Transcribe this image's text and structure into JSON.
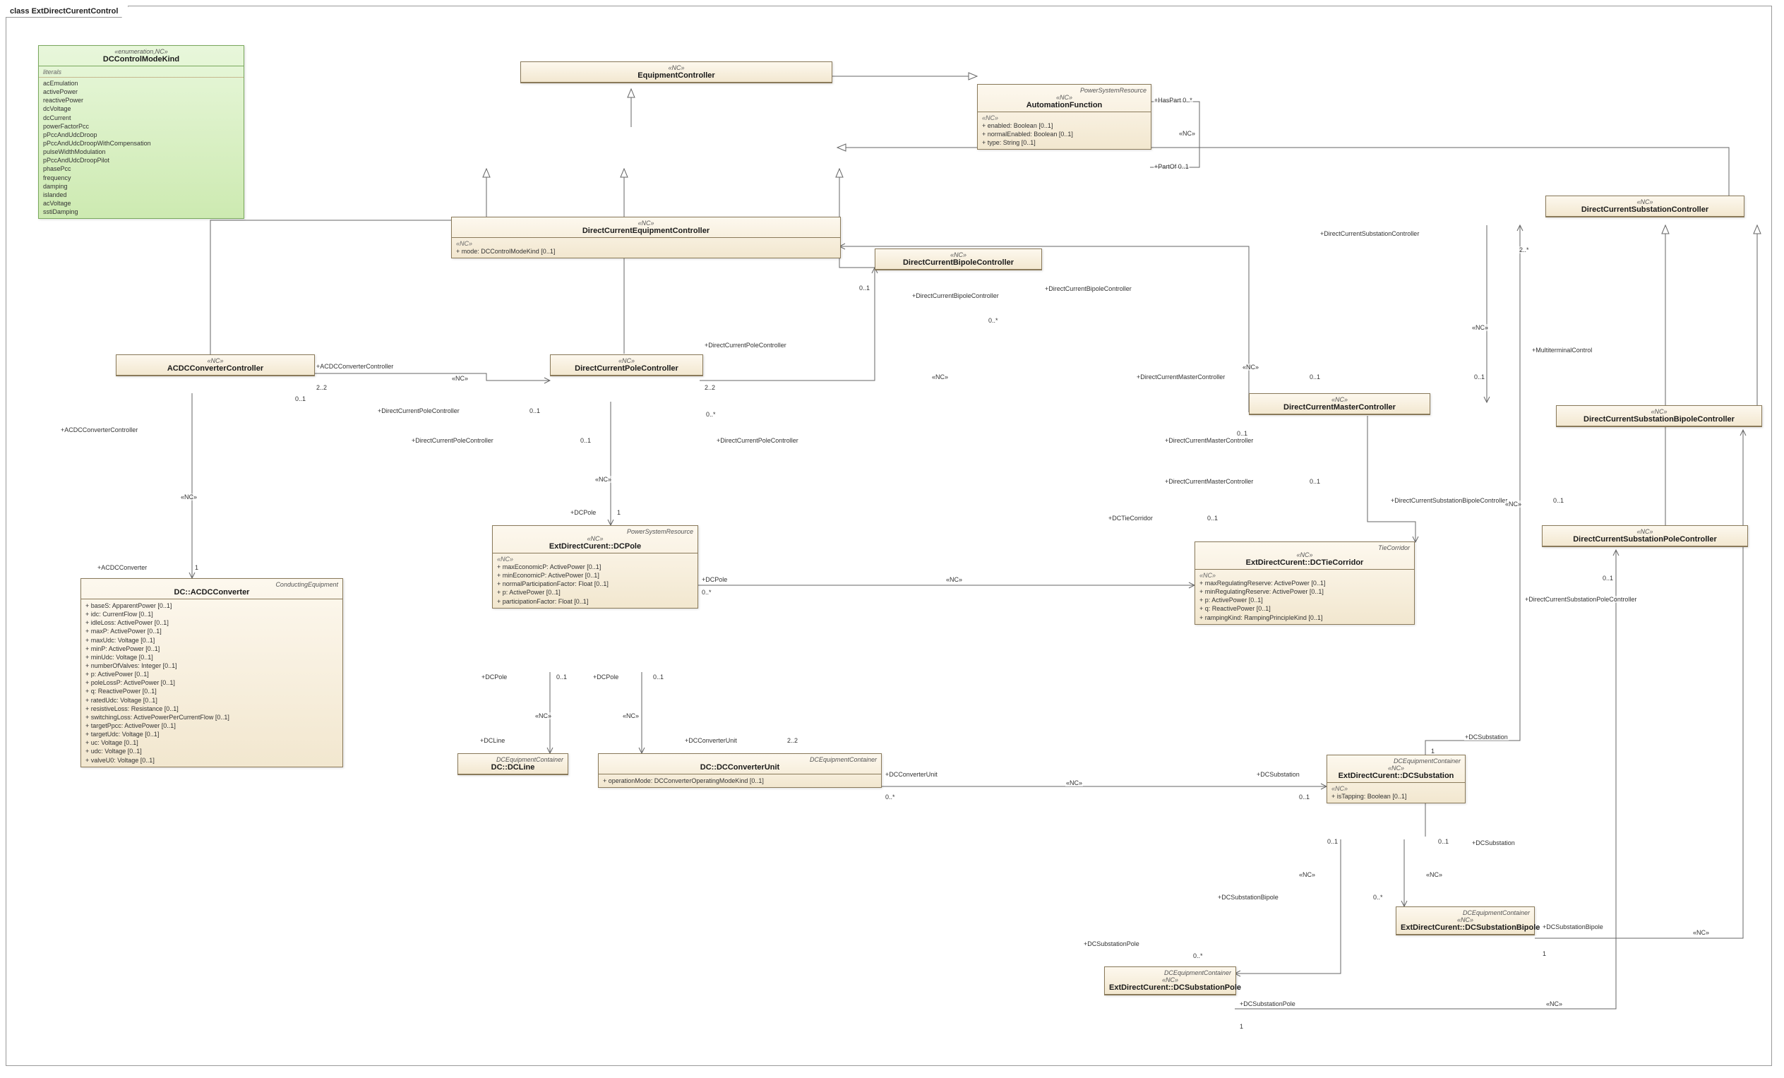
{
  "title": "class ExtDirectCurentControl",
  "enumeration": {
    "stereotype": "«enumeration,NC»",
    "name": "DCControlModeKind",
    "literals_label": "literals",
    "literals": [
      "acEmulation",
      "activePower",
      "reactivePower",
      "dcVoltage",
      "dcCurrent",
      "powerFactorPcc",
      "pPccAndUdcDroop",
      "pPccAndUdcDroopWithCompensation",
      "pulseWidthModulation",
      "pPccAndUdcDroopPilot",
      "phasePcc",
      "frequency",
      "damping",
      "islanded",
      "acVoltage",
      "sstiDamping"
    ]
  },
  "classes": {
    "equipment_controller": {
      "stereotype": "«NC»",
      "name": "EquipmentController"
    },
    "dc_equipment_controller": {
      "stereotype": "«NC»",
      "name": "DirectCurrentEquipmentController",
      "section_stereo": "«NC»",
      "attrs": [
        "+   mode: DCControlModeKind [0..1]"
      ]
    },
    "automation_function": {
      "parent_stereo": "PowerSystemResource",
      "stereotype": "«NC»",
      "name": "AutomationFunction",
      "section_stereo": "«NC»",
      "attrs": [
        "+   enabled: Boolean [0..1]",
        "+   normalEnabled: Boolean [0..1]",
        "+   type: String [0..1]"
      ]
    },
    "acdc_conv_controller": {
      "stereotype": "«NC»",
      "name": "ACDCConverterController"
    },
    "dc_pole_controller": {
      "stereotype": "«NC»",
      "name": "DirectCurrentPoleController"
    },
    "dc_bipole_controller": {
      "stereotype": "«NC»",
      "name": "DirectCurrentBipoleController"
    },
    "dc_master_controller": {
      "stereotype": "«NC»",
      "name": "DirectCurrentMasterController"
    },
    "dc_sub_controller": {
      "stereotype": "«NC»",
      "name": "DirectCurrentSubstationController"
    },
    "dc_sub_bipole_controller": {
      "stereotype": "«NC»",
      "name": "DirectCurrentSubstationBipoleController"
    },
    "dc_sub_pole_controller": {
      "stereotype": "«NC»",
      "name": "DirectCurrentSubstationPoleController"
    },
    "acdc_converter": {
      "parent_stereo": "ConductingEquipment",
      "name": "DC::ACDCConverter",
      "attrs": [
        "+   baseS: ApparentPower [0..1]",
        "+   idc: CurrentFlow [0..1]",
        "+   idleLoss: ActivePower [0..1]",
        "+   maxP: ActivePower [0..1]",
        "+   maxUdc: Voltage [0..1]",
        "+   minP: ActivePower [0..1]",
        "+   minUdc: Voltage [0..1]",
        "+   numberOfValves: Integer [0..1]",
        "+   p: ActivePower [0..1]",
        "+   poleLossP: ActivePower [0..1]",
        "+   q: ReactivePower [0..1]",
        "+   ratedUdc: Voltage [0..1]",
        "+   resistiveLoss: Resistance [0..1]",
        "+   switchingLoss: ActivePowerPerCurrentFlow [0..1]",
        "+   targetPpcc: ActivePower [0..1]",
        "+   targetUdc: Voltage [0..1]",
        "+   uc: Voltage [0..1]",
        "+   udc: Voltage [0..1]",
        "+   valveU0: Voltage [0..1]"
      ]
    },
    "dc_pole": {
      "parent_stereo": "PowerSystemResource",
      "stereotype": "«NC»",
      "name": "ExtDirectCurent::DCPole",
      "section_stereo": "«NC»",
      "attrs": [
        "+   maxEconomicP: ActivePower [0..1]",
        "+   minEconomicP: ActivePower [0..1]",
        "+   normalParticipationFactor: Float [0..1]",
        "+   p: ActivePower [0..1]",
        "+   participationFactor: Float [0..1]"
      ]
    },
    "dc_tie_corridor": {
      "parent_stereo": "TieCorridor",
      "stereotype": "«NC»",
      "name": "ExtDirectCurent::DCTieCorridor",
      "section_stereo": "«NC»",
      "attrs": [
        "+   maxRegulatingReserve: ActivePower [0..1]",
        "+   minRegulatingReserve: ActivePower [0..1]",
        "+   p: ActivePower [0..1]",
        "+   q: ReactivePower [0..1]",
        "+   rampingKind: RampingPrincipleKind [0..1]"
      ]
    },
    "dc_line": {
      "parent_stereo": "DCEquipmentContainer",
      "name": "DC::DCLine"
    },
    "dc_converter_unit": {
      "parent_stereo": "DCEquipmentContainer",
      "name": "DC::DCConverterUnit",
      "attrs": [
        "+   operationMode: DCConverterOperatingModeKind [0..1]"
      ]
    },
    "dc_substation": {
      "parent_stereo": "DCEquipmentContainer",
      "stereotype": "«NC»",
      "name": "ExtDirectCurent::DCSubstation",
      "section_stereo": "«NC»",
      "attrs": [
        "+   isTapping: Boolean [0..1]"
      ]
    },
    "dc_sub_bipole": {
      "parent_stereo": "DCEquipmentContainer",
      "stereotype": "«NC»",
      "name": "ExtDirectCurent::DCSubstationBipole"
    },
    "dc_sub_pole": {
      "parent_stereo": "DCEquipmentContainer",
      "stereotype": "«NC»",
      "name": "ExtDirectCurent::DCSubstationPole"
    }
  },
  "edge_labels": {
    "nc": "«NC»",
    "haspart": "+HasPart 0..*",
    "partof": "+PartOf 0..1",
    "acdcconvctrl": "+ACDCConverterController",
    "dcpolectrl": "+DirectCurrentPoleController",
    "dcbipolectrl": "+DirectCurrentBipoleController",
    "dcmasterctrl": "+DirectCurrentMasterController",
    "dcsubctrl": "+DirectCurrentSubstationController",
    "dcsubbipolectrl": "+DirectCurrentSubstationBipoleController",
    "dcsubpolectrl": "+DirectCurrentSubstationPoleController",
    "multiterm": "+MultiterminalControl",
    "acdcconv": "+ACDCConverter",
    "dcpole": "+DCPole",
    "dcline": "+DCLine",
    "dcconvunit": "+DCConverterUnit",
    "dcsubstation": "+DCSubstation",
    "dcsubstationbipole": "+DCSubstationBipole",
    "dcsubstationpole": "+DCSubstationPole",
    "dctiecorridor": "+DCTieCorridor",
    "m_0_1": "0..1",
    "m_0_n": "0..*",
    "m_1": "1",
    "m_2_2": "2..2",
    "m_2_n": "2..*"
  }
}
